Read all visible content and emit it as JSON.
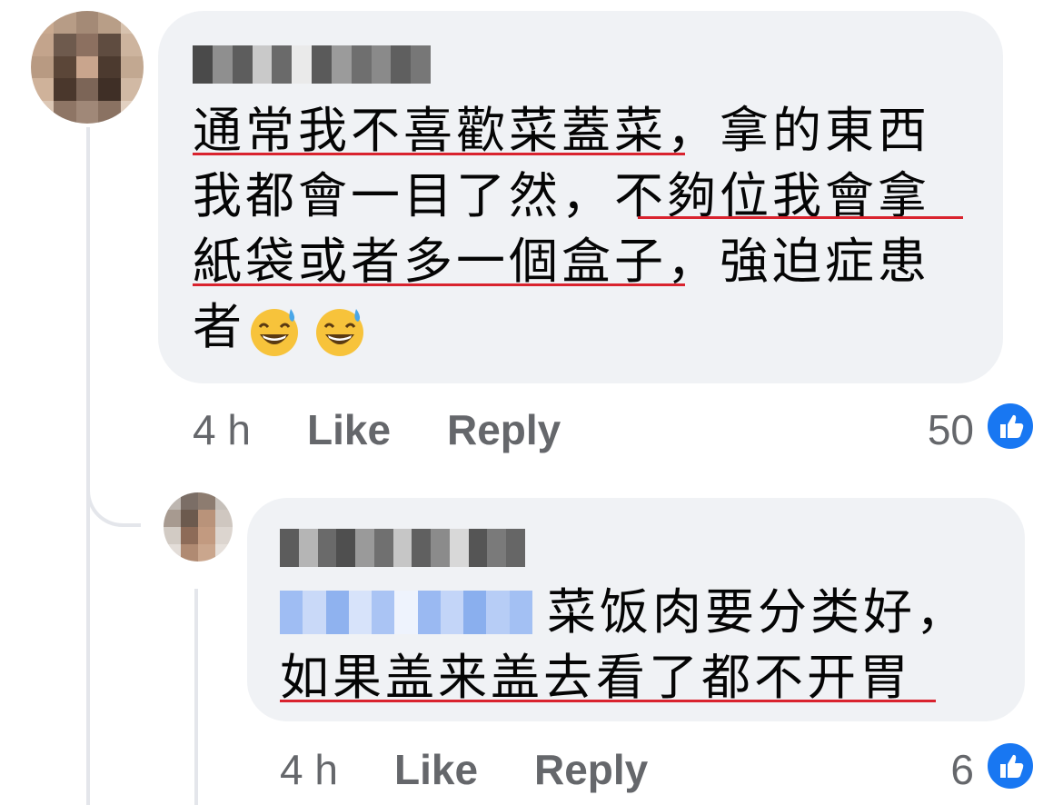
{
  "comments": [
    {
      "author_name": "Kathy Pang",
      "text_lines": [
        "通常我不喜歡菜蓋菜，拿的東西",
        "我都會一目了然，不夠位我會拿",
        "紙袋或者多一個盒子，強迫症患",
        "者"
      ],
      "emoji": [
        "grinning-sweat",
        "grinning-sweat"
      ],
      "time": "4 h",
      "like_label": "Like",
      "reply_label": "Reply",
      "reaction_count": "50"
    },
    {
      "author_name": "Jeffrey Lim",
      "mention": "Kathy Pang",
      "text_line1": "菜饭肉要分类好，",
      "text_line2": "如果盖来盖去看了都不开胃",
      "time": "4 h",
      "like_label": "Like",
      "reply_label": "Reply",
      "reaction_count": "6"
    }
  ],
  "colors": {
    "bubble": "#f0f2f5",
    "underline": "#d9232e",
    "like_blue": "#1877f2",
    "meta_gray": "#65676b",
    "mention_blur": "#a9c3f5"
  }
}
